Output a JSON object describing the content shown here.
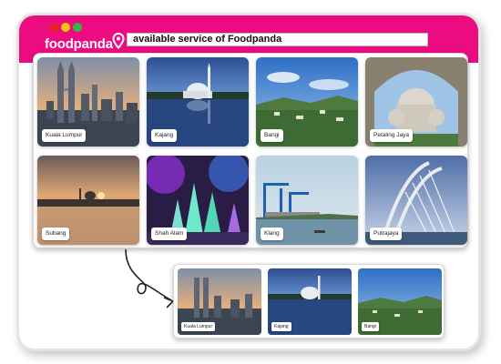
{
  "window": {
    "brand": "foodpanda",
    "address": "available service of Foodpanda",
    "accent_color": "#ed0b82",
    "controls": [
      "close",
      "minimize",
      "maximize"
    ]
  },
  "cities": [
    {
      "label": "Kuala Lumpur"
    },
    {
      "label": "Kajang"
    },
    {
      "label": "Bangi"
    },
    {
      "label": "Petaling Jaya"
    },
    {
      "label": "Subang"
    },
    {
      "label": "Shah Alam"
    },
    {
      "label": "Klang"
    },
    {
      "label": "Putrajaya"
    }
  ],
  "preview": [
    {
      "label": "Kuala Lumpur"
    },
    {
      "label": "Kajang"
    },
    {
      "label": "Bangi"
    }
  ]
}
